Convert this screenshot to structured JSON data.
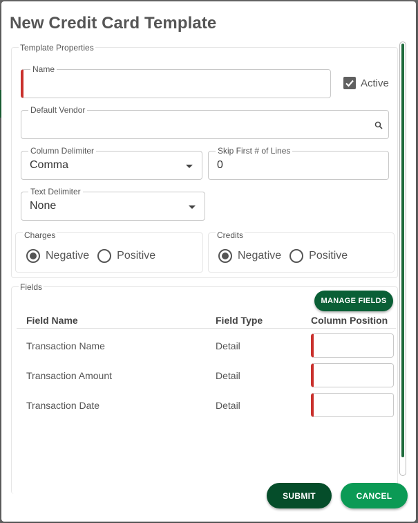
{
  "dialog": {
    "title": "New Credit Card Template"
  },
  "template_properties": {
    "legend": "Template Properties",
    "name": {
      "label": "Name",
      "value": ""
    },
    "active": {
      "label": "Active",
      "checked": true
    },
    "default_vendor": {
      "label": "Default Vendor",
      "value": ""
    },
    "column_delimiter": {
      "label": "Column Delimiter",
      "value": "Comma"
    },
    "skip_lines": {
      "label": "Skip First # of Lines",
      "value": "0"
    },
    "text_delimiter": {
      "label": "Text Delimiter",
      "value": "None"
    },
    "charges": {
      "legend": "Charges",
      "option_negative": "Negative",
      "option_positive": "Positive",
      "selected": "Negative"
    },
    "credits": {
      "legend": "Credits",
      "option_negative": "Negative",
      "option_positive": "Positive",
      "selected": "Negative"
    }
  },
  "fields": {
    "legend": "Fields",
    "manage_label": "MANAGE FIELDS",
    "columns": [
      "Field Name",
      "Field Type",
      "Column Position"
    ],
    "rows": [
      {
        "name": "Transaction Name",
        "type": "Detail",
        "position": ""
      },
      {
        "name": "Transaction Amount",
        "type": "Detail",
        "position": ""
      },
      {
        "name": "Transaction Date",
        "type": "Detail",
        "position": ""
      }
    ]
  },
  "footer": {
    "submit_label": "SUBMIT",
    "cancel_label": "CANCEL"
  },
  "colors": {
    "accent_dark": "#054d2a",
    "accent": "#0b9a55",
    "required": "#c9302c",
    "scrollbar": "#1e6b3c"
  },
  "icons": {
    "vendor_search": "search-icon",
    "active_checkbox": "check-icon",
    "delimiter_dropdown": "chevron-down-icon"
  }
}
